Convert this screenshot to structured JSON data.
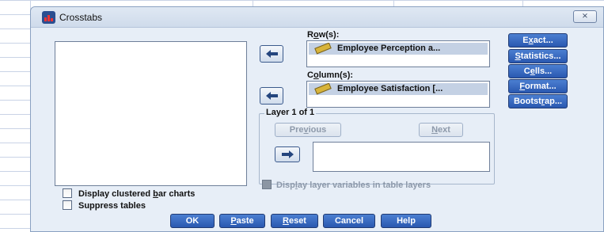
{
  "dialog": {
    "title": "Crosstabs",
    "close_label": "⨯"
  },
  "rows": {
    "label_pre": "R",
    "label_u": "o",
    "label_post": "w(s):",
    "variable": "Employee Perception a..."
  },
  "columns": {
    "label_pre": "C",
    "label_u": "o",
    "label_post": "lumn(s):",
    "variable": "Employee Satisfaction [..."
  },
  "layer": {
    "title": "Layer 1 of 1",
    "previous": {
      "pre": "Pre",
      "u": "v",
      "post": "ious"
    },
    "next": {
      "pre": "",
      "u": "N",
      "post": "ext"
    }
  },
  "display_layer_vars": {
    "pre": "Disp",
    "u": "l",
    "post": "ay layer variables in table layers"
  },
  "checkboxes": {
    "clustered": {
      "pre": "Display clustered ",
      "u": "b",
      "post": "ar charts"
    },
    "suppress": {
      "pre": "Suppress tables",
      "u": "",
      "post": ""
    }
  },
  "side_buttons": {
    "exact": {
      "pre": "E",
      "u": "x",
      "post": "act..."
    },
    "statistics": {
      "pre": "",
      "u": "S",
      "post": "tatistics..."
    },
    "cells": {
      "pre": "C",
      "u": "e",
      "post": "lls..."
    },
    "format": {
      "pre": "",
      "u": "F",
      "post": "ormat..."
    },
    "bootstrap": {
      "pre": "Bootst",
      "u": "r",
      "post": "ap..."
    }
  },
  "bottom_buttons": {
    "ok": {
      "pre": "OK",
      "u": "",
      "post": ""
    },
    "paste": {
      "pre": "",
      "u": "P",
      "post": "aste"
    },
    "reset": {
      "pre": "",
      "u": "R",
      "post": "eset"
    },
    "cancel": {
      "pre": "Cancel",
      "u": "",
      "post": ""
    },
    "help": {
      "pre": "Help",
      "u": "",
      "post": ""
    }
  },
  "colors": {
    "dialog_bg": "#e7eef7",
    "button_blue": "#2a58b0",
    "selected_var_bg": "#c4d1e4"
  },
  "icons": [
    "app-icon",
    "close-icon",
    "arrow-left-icon",
    "arrow-right-icon",
    "scale-variable-icon"
  ]
}
